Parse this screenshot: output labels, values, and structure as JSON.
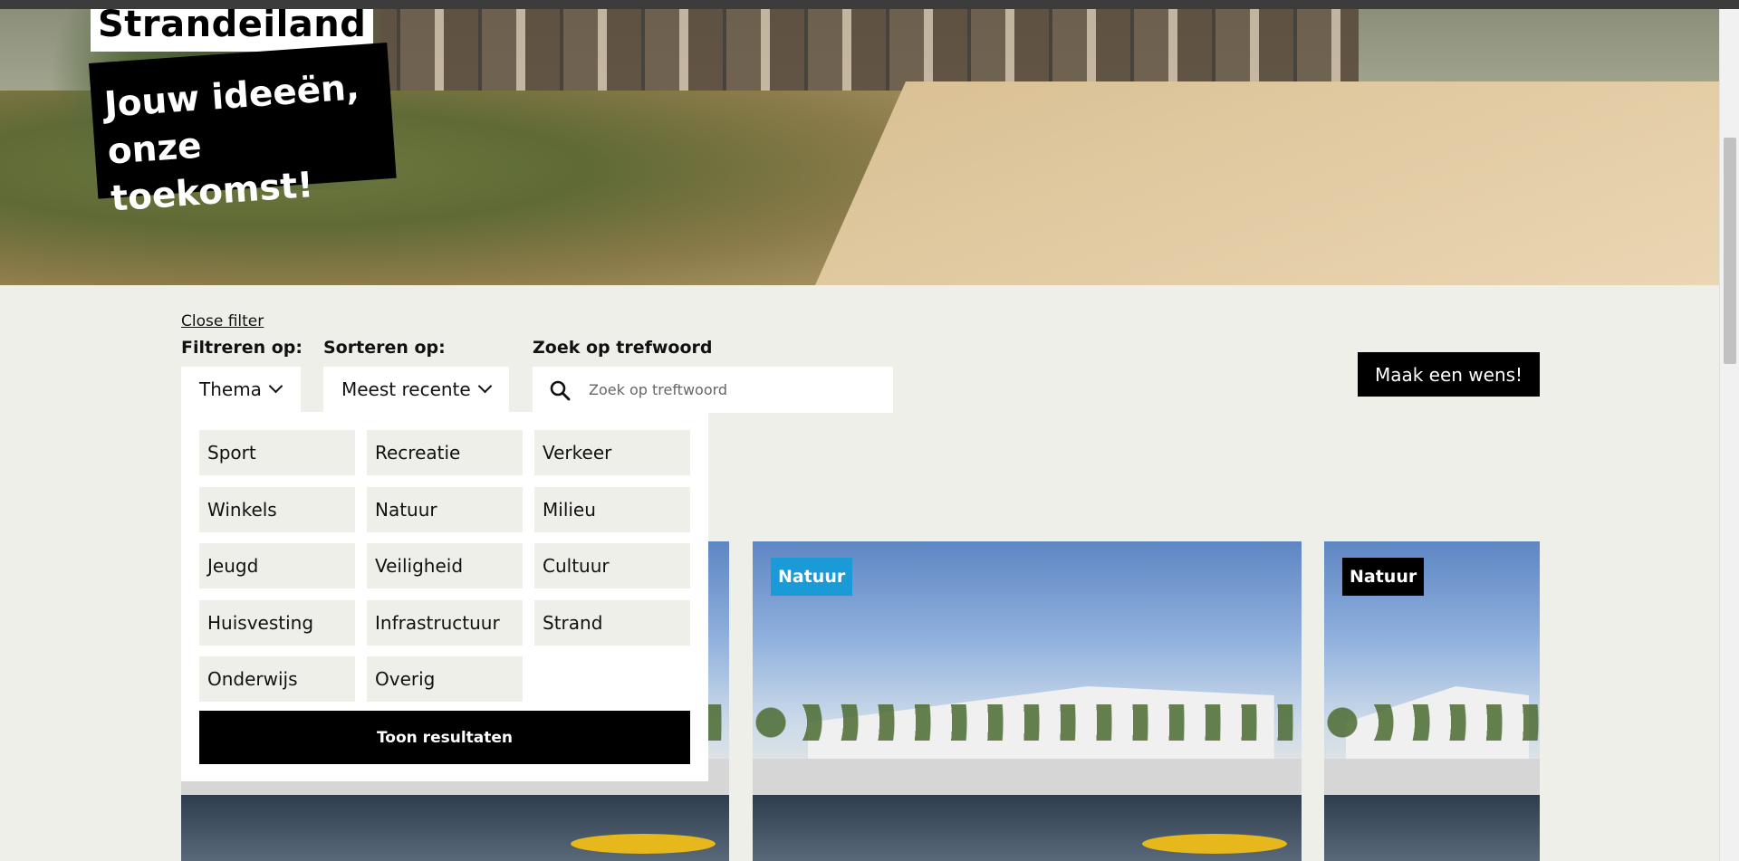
{
  "hero": {
    "brand": "Strandeiland",
    "slogan_line1": "Jouw ideeën,",
    "slogan_line2": "onze toekomst!"
  },
  "filter": {
    "close_label": "Close filter",
    "filter_label": "Filtreren op:",
    "sort_label": "Sorteren op:",
    "search_label": "Zoek op trefwoord",
    "thema_value": "Thema",
    "sort_value": "Meest recente",
    "search_placeholder": "Zoek op treftwoord",
    "options": [
      "Sport",
      "Recreatie",
      "Verkeer",
      "Winkels",
      "Natuur",
      "Milieu",
      "Jeugd",
      "Veiligheid",
      "Cultuur",
      "Huisvesting",
      "Infrastructuur",
      "Strand",
      "Onderwijs",
      "Overig"
    ],
    "show_results": "Toon resultaten"
  },
  "wish_button": "Maak een wens!",
  "cards": [
    {
      "tag": "Natuur",
      "tag_color": "#1a9ad6"
    },
    {
      "tag": "Natuur",
      "tag_color": "#000000"
    }
  ],
  "colors": {
    "background": "#efefea",
    "accent_blue": "#1a9ad6",
    "black": "#000000"
  }
}
